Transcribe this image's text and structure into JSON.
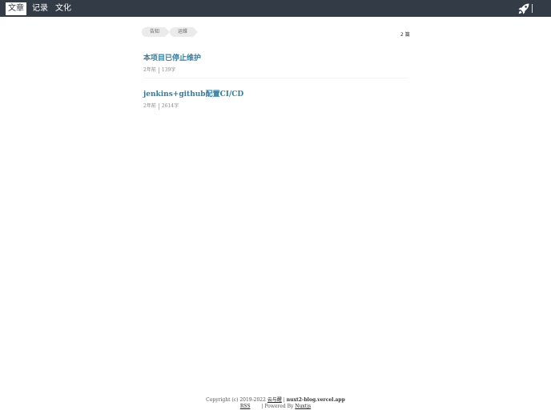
{
  "nav": {
    "items": [
      {
        "label": "文章",
        "active": true
      },
      {
        "label": "记录",
        "active": false
      },
      {
        "label": "文化",
        "active": false
      }
    ],
    "right_icon": "rocket-icon"
  },
  "tabs": [
    {
      "label": "告知"
    },
    {
      "label": "运维"
    }
  ],
  "post_count": "2 篇",
  "posts": [
    {
      "title": "本项目已停止维护",
      "time": "2年前",
      "words": "139字"
    },
    {
      "title": "jenkins+github配置CI/CD",
      "time": "2年前",
      "words": "2614字"
    }
  ],
  "footer": {
    "copyright": "Copyright (c) 2019-2022",
    "author": "云与醒",
    "site": "nuxt2-blog.vercel.app",
    "rss": "RSS",
    "powered_prefix": "| Powered By",
    "powered_by": "Nuxtjs"
  },
  "colors": {
    "topbar": "#333b46",
    "link": "#2e7ea6",
    "tab_bg": "#ebebeb"
  }
}
